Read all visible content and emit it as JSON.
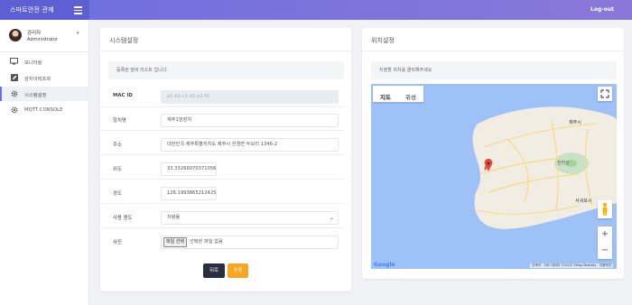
{
  "header": {
    "brand": "스마트안전 관제",
    "logout": "Log-out"
  },
  "user": {
    "name": "관리자",
    "role": "Administrator"
  },
  "sidebar": {
    "items": [
      {
        "icon": "monitor-icon",
        "label": "모니터링"
      },
      {
        "icon": "edit-icon",
        "label": "감지이력조회"
      },
      {
        "icon": "gear-icon",
        "label": "시스템설정"
      },
      {
        "icon": "gear-icon",
        "label": "MQTT CONSOLE"
      }
    ]
  },
  "system": {
    "title": "시스템설정",
    "info": "등록된 장비 리스트 입니다.",
    "fields": [
      {
        "label": "MAC ID",
        "value": "a1-b1-c1-d1-e1-f2"
      },
      {
        "label": "장치명",
        "value": "제주1번장치"
      },
      {
        "label": "주소",
        "value": "대한민국 제주특별자치도 제주시 한경면 두모리 1346-2"
      },
      {
        "label": "위도",
        "value": "33.332660703710560"
      },
      {
        "label": "경도",
        "value": "126.199386521242590"
      },
      {
        "label": "사용 용도",
        "value": "차량용"
      },
      {
        "label": "사진",
        "file_button": "파일 선택",
        "file_status": "선택된 파일 없음"
      }
    ],
    "back_button": "뒤로",
    "edit_button": "수정"
  },
  "location": {
    "title": "위치설정",
    "info": "지정할 위치를 클릭해주세요",
    "map_tabs": [
      "지도",
      "위성"
    ],
    "city_labels": [
      "제주시",
      "한라산",
      "서귀포시"
    ],
    "footer": "단축키 · 지도 데이터 ©2022 TMap Mobility · 이용약관",
    "google": "Google"
  },
  "colors": {
    "accent": "#6c6ee0",
    "edit": "#f5a623",
    "back": "#2b2d42"
  }
}
